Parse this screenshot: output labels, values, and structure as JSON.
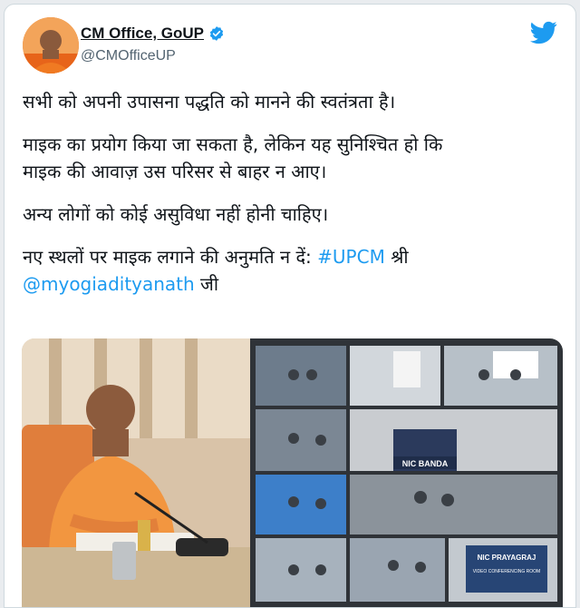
{
  "tweet": {
    "display_name": "CM Office, GoUP",
    "handle": "@CMOfficeUP",
    "line1": "सभी को अपनी उपासना पद्धति को मानने की स्वतंत्रता है।",
    "line2a": "माइक का प्रयोग किया जा सकता है, लेकिन यह सुनिश्चित हो कि",
    "line2b": "माइक की आवाज़ उस परिसर से बाहर न आए।",
    "line3": "अन्य लोगों को कोई असुविधा नहीं होनी चाहिए।",
    "line4_prefix": "नए स्थलों पर माइक लगाने की अनुमति न दें: ",
    "hashtag": "#UPCM",
    "line4_suffix": " श्री",
    "mention": "@myogiadityanath",
    "line5_suffix": " जी"
  },
  "media": {
    "screen_labels": [
      "NIC BANDA",
      "NIC PRAYAGRAJ",
      "VIDEO CONFERENCING ROOM"
    ]
  },
  "colors": {
    "link": "#1d9bf0",
    "verified": "#1d9bf0",
    "twitter_bird": "#1d9bf0",
    "saffron": "#f07a22"
  }
}
